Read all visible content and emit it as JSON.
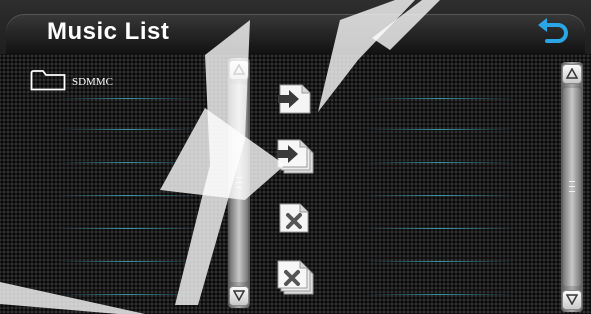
{
  "header": {
    "title": "Music List",
    "back_icon": "return-arrow-icon",
    "back_icon_color": "#2aa6e6"
  },
  "file_list": {
    "items": [
      {
        "icon": "folder-icon",
        "label": "SDMMC"
      }
    ]
  },
  "actions": [
    {
      "name": "add-file-button",
      "icon": "add-file-icon"
    },
    {
      "name": "add-all-files-button",
      "icon": "add-all-files-icon"
    },
    {
      "name": "delete-file-button",
      "icon": "delete-file-icon"
    },
    {
      "name": "delete-all-files-button",
      "icon": "delete-all-files-icon"
    }
  ],
  "scrollbars": {
    "left": {
      "up_icon": "triangle-up-icon",
      "down_icon": "triangle-down-icon",
      "grip_icon": "grip-lines-icon"
    },
    "right": {
      "up_icon": "triangle-up-icon",
      "down_icon": "triangle-down-icon",
      "grip_icon": "grip-lines-icon"
    }
  },
  "colors": {
    "accent": "#2aa6e6",
    "row_separator_glow": "#3caabe",
    "watermark": "#ffffff"
  }
}
